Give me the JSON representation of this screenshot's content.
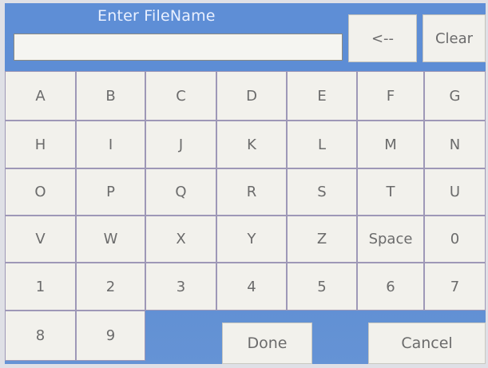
{
  "header": {
    "title": "Enter FileName"
  },
  "filename_input": {
    "value": ""
  },
  "toolbar": {
    "backspace_label": "<--",
    "clear_label": "Clear"
  },
  "keyboard": {
    "rows": [
      [
        "A",
        "B",
        "C",
        "D",
        "E",
        "F",
        "G"
      ],
      [
        "H",
        "I",
        "J",
        "K",
        "L",
        "M",
        "N"
      ],
      [
        "O",
        "P",
        "Q",
        "R",
        "S",
        "T",
        "U"
      ],
      [
        "V",
        "W",
        "X",
        "Y",
        "Z",
        "Space",
        "0"
      ],
      [
        "1",
        "2",
        "3",
        "4",
        "5",
        "6",
        "7"
      ],
      [
        "8",
        "9"
      ]
    ]
  },
  "actions": {
    "done_label": "Done",
    "cancel_label": "Cancel"
  },
  "colors": {
    "panel": "#5f8fd4",
    "key": "#f2f1ec",
    "key_text": "#6b6b6b",
    "title": "#e9f0ff"
  }
}
